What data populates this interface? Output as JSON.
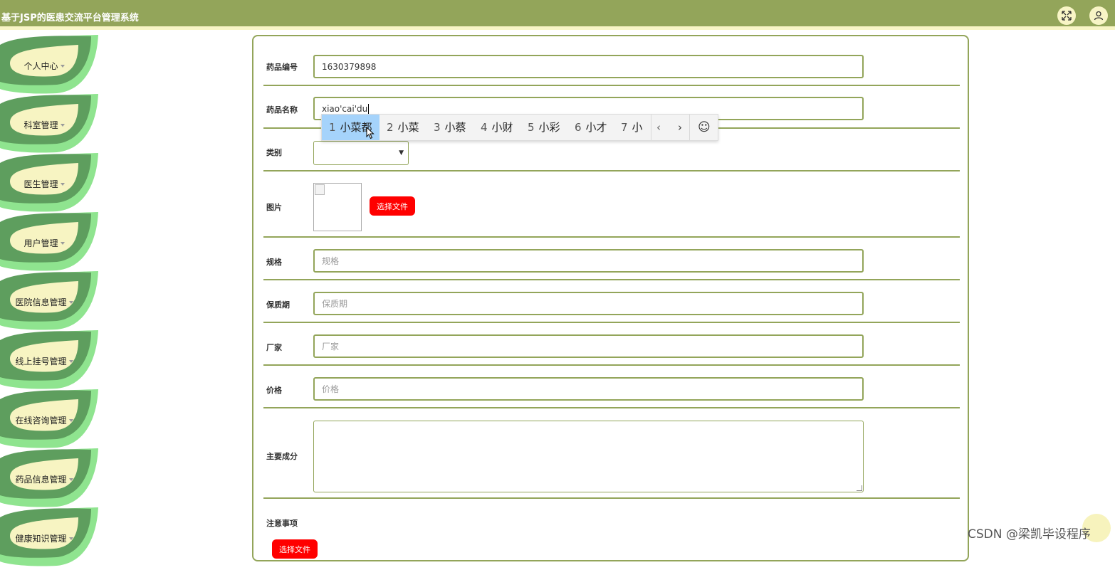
{
  "app": {
    "title": "基于JSP的医患交流平台管理系统"
  },
  "header": {
    "icons": [
      "fullscreen-icon",
      "user-icon"
    ],
    "colors": {
      "bar": "#93a55a",
      "accent": "#f8f5c6"
    }
  },
  "sidebar": {
    "items": [
      {
        "label": "个人中心"
      },
      {
        "label": "科室管理"
      },
      {
        "label": "医生管理"
      },
      {
        "label": "用户管理"
      },
      {
        "label": "医院信息管理"
      },
      {
        "label": "线上挂号管理"
      },
      {
        "label": "在线咨询管理"
      },
      {
        "label": "药品信息管理"
      },
      {
        "label": "健康知识管理"
      }
    ]
  },
  "form": {
    "code": {
      "label": "药品编号",
      "value": "1630379898"
    },
    "name": {
      "label": "药品名称",
      "value": "xiao'cai'du"
    },
    "category": {
      "label": "类别",
      "value": ""
    },
    "image": {
      "label": "图片",
      "button": "选择文件"
    },
    "spec": {
      "label": "规格",
      "placeholder": "规格"
    },
    "shelf_life": {
      "label": "保质期",
      "placeholder": "保质期"
    },
    "manufacturer": {
      "label": "厂家",
      "placeholder": "厂家"
    },
    "price": {
      "label": "价格",
      "placeholder": "价格"
    },
    "ingredients": {
      "label": "主要成分",
      "value": ""
    },
    "notes": {
      "label": "注意事项",
      "button": "选择文件"
    }
  },
  "ime": {
    "candidates": [
      {
        "num": "1",
        "text": "小菜都"
      },
      {
        "num": "2",
        "text": "小菜"
      },
      {
        "num": "3",
        "text": "小蔡"
      },
      {
        "num": "4",
        "text": "小财"
      },
      {
        "num": "5",
        "text": "小彩"
      },
      {
        "num": "6",
        "text": "小才"
      },
      {
        "num": "7",
        "text": "小"
      }
    ],
    "prev": "‹",
    "next": "›",
    "emoji": "☺"
  },
  "watermark": {
    "text": "CSDN @梁凯毕设程序"
  }
}
